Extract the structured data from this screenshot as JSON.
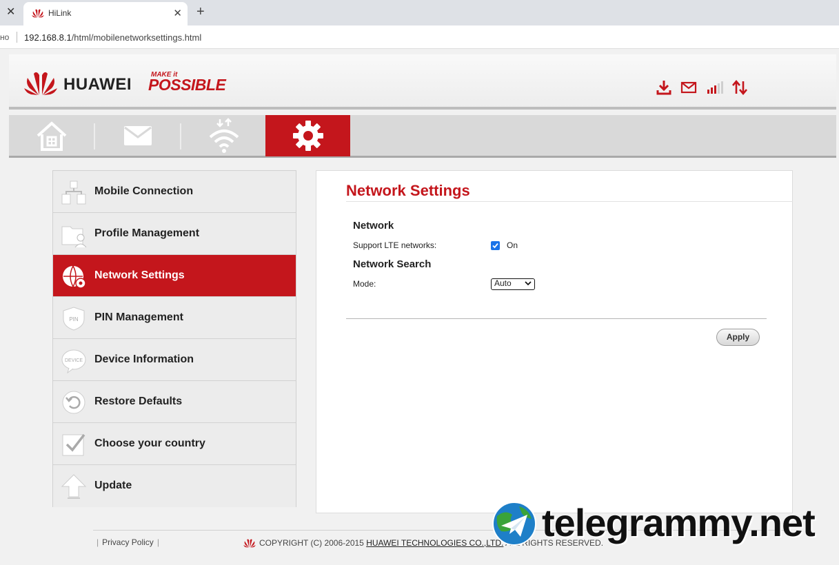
{
  "browser": {
    "tab_title": "HiLink",
    "address_prefix": "но",
    "address_host": "192.168.8.1",
    "address_path": "/html/mobilenetworksettings.html"
  },
  "header": {
    "brand": "HUAWEI",
    "slogan_small": "MAKE it",
    "slogan_big": "POSSIBLE",
    "icons": [
      "download-icon",
      "mail-icon",
      "signal-icon",
      "data-transfer-icon"
    ]
  },
  "nav": {
    "items": [
      "home-icon",
      "sms-icon",
      "wifi-icon",
      "settings-icon"
    ],
    "active": "settings"
  },
  "sidebar": {
    "items": [
      {
        "label": "Mobile Connection"
      },
      {
        "label": "Profile Management"
      },
      {
        "label": "Network Settings"
      },
      {
        "label": "PIN Management"
      },
      {
        "label": "Device Information"
      },
      {
        "label": "Restore Defaults"
      },
      {
        "label": "Choose your country"
      },
      {
        "label": "Update"
      }
    ],
    "active_index": 2
  },
  "main": {
    "title": "Network Settings",
    "network_heading": "Network",
    "lte_label": "Support LTE networks:",
    "lte_checked": true,
    "lte_value": "On",
    "search_heading": "Network Search",
    "mode_label": "Mode:",
    "mode_value": "Auto",
    "apply_label": "Apply"
  },
  "footer": {
    "privacy": "Privacy Policy",
    "copyright_prefix": "COPYRIGHT (C) 2006-2015",
    "company": "HUAWEI TECHNOLOGIES CO.,LTD.",
    "copyright_suffix": "ALL RIGHTS RESERVED."
  },
  "watermark": {
    "text": "telegrammy.net"
  },
  "colors": {
    "brand_red": "#c4161c",
    "nav_bg": "#d9d9d9",
    "checkbox_blue": "#1a73e8"
  }
}
